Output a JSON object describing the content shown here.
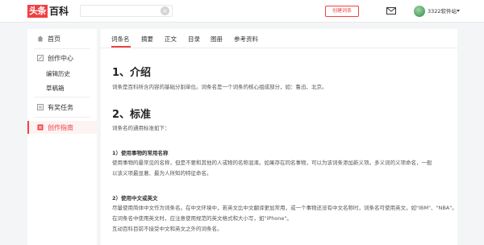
{
  "header": {
    "logo_red": "头条",
    "logo_black": "百科",
    "search_clear_glyph": "×",
    "create_button": "创建词条",
    "username": "3322软件站"
  },
  "sidebar": {
    "home": "首页",
    "creation_center": "创作中心",
    "edit_history": "编辑历史",
    "drafts": "草稿箱",
    "rewarded_tasks": "有奖任务",
    "creation_guide": "创作指南"
  },
  "tabs": [
    "词条名",
    "摘要",
    "正文",
    "目录",
    "图册",
    "参考资料"
  ],
  "content": {
    "section1_title": "1、介绍",
    "section1_text": "词条是百科所含内容的基础分割单位。词条名是一个词条的核心组成部分，如：鲁迅、北京。",
    "section2_title": "2、标准",
    "section2_intro": "词条名的通用标准如下：",
    "sub1_title": "1）使用事物的常用名称",
    "sub1_line1": "使用事物的最常见的名称，但是不要和其他的人或物的名称混淆。如果存在同名事物，可以为该词条添加新义项。多义词的义项命名，一般",
    "sub1_line2": "以该义项最显著、最为人所知的特征命名。",
    "sub2_title": "2）使用中文或英文",
    "sub2_line1": "尽量使用简体中文作为词条名。在中文环境中，若英文比中文翻译更加常用，或一个事物还没有中文名称时，词条名可使用英文，如\"IBM\"、\"NBA\"。",
    "sub2_line2": "在词条名中使用英文时，应注意使用规范的英文格式和大小写，如\"iPhone\"。",
    "sub2_line3": "互动百科目前不接受中文和英文之外的词条名。"
  },
  "colors": {
    "accent": "#f04142",
    "background": "#f4f5f6"
  }
}
